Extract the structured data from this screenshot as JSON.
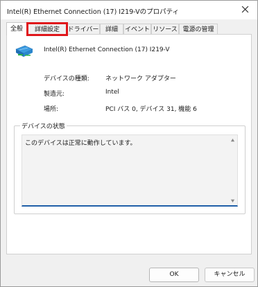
{
  "window": {
    "title": "Intel(R) Ethernet Connection (17) I219-Vのプロパティ",
    "close_icon": "close-icon"
  },
  "tabs": [
    {
      "label": "全般",
      "active": true
    },
    {
      "label": "詳細設定",
      "highlighted": true
    },
    {
      "label": "ドライバー"
    },
    {
      "label": "詳細"
    },
    {
      "label": "イベント"
    },
    {
      "label": "リソース"
    },
    {
      "label": "電源の管理"
    }
  ],
  "general": {
    "device_icon": "network-adapter-icon",
    "device_name": "Intel(R) Ethernet Connection (17) I219-V",
    "properties": [
      {
        "label": "デバイスの種類:",
        "value": "ネットワーク アダプター"
      },
      {
        "label": "製造元:",
        "value": "Intel"
      },
      {
        "label": "場所:",
        "value": "PCI バス 0, デバイス 31, 機能 6"
      }
    ],
    "status_group_label": "デバイスの状態",
    "status_text": "このデバイスは正常に動作しています。"
  },
  "buttons": {
    "ok": "OK",
    "cancel": "キャンセル"
  },
  "colors": {
    "highlight": "#e0161b",
    "status_underline": "#1f5fa8"
  }
}
